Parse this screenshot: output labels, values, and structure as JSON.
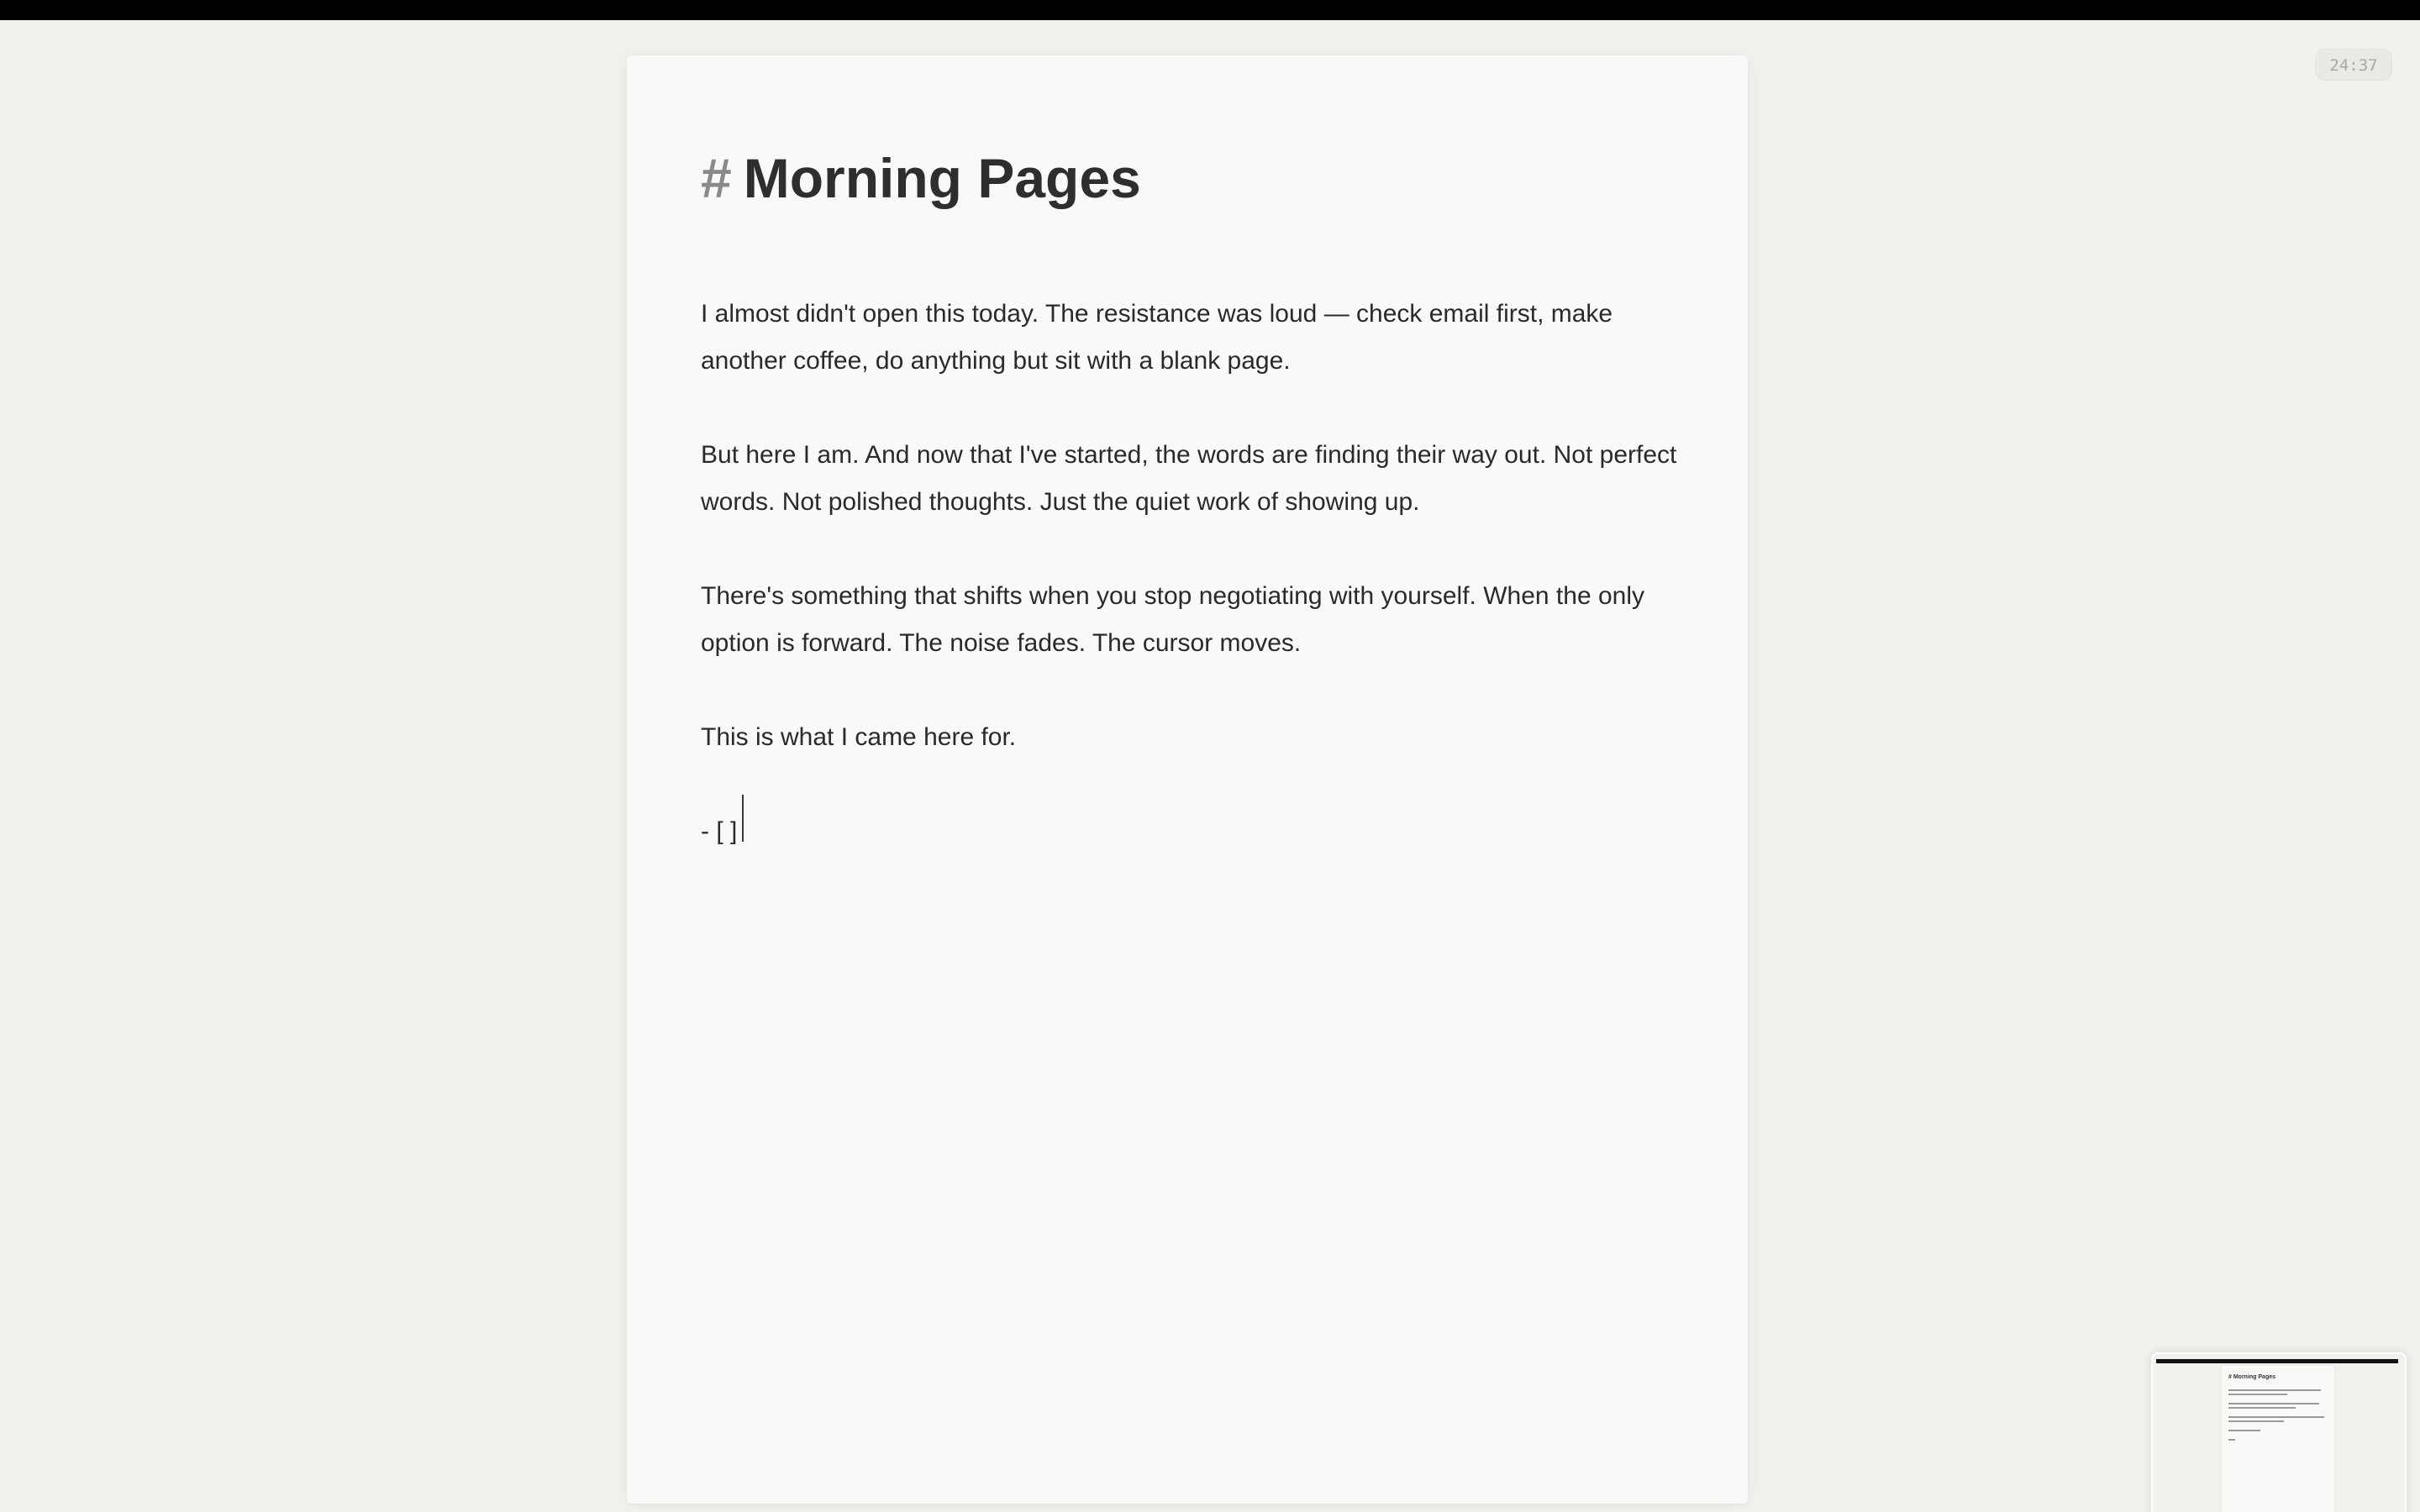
{
  "timer": {
    "value": "24:37"
  },
  "document": {
    "heading_marker": "#",
    "title": "Morning Pages",
    "paragraphs": [
      "I almost didn't open this today. The resistance was loud — check email first, make another coffee, do anything but sit with a blank page.",
      "But here I am. And now that I've started, the words are finding their way out. Not perfect words. Not polished thoughts. Just the quiet work of showing up.",
      "There's something that shifts when you stop negotiating with yourself. When the only option is forward. The noise fades. The cursor moves.",
      "This is what I came here for."
    ],
    "current_line": "- [ ]"
  },
  "minimap": {
    "title": "# Morning Pages"
  }
}
